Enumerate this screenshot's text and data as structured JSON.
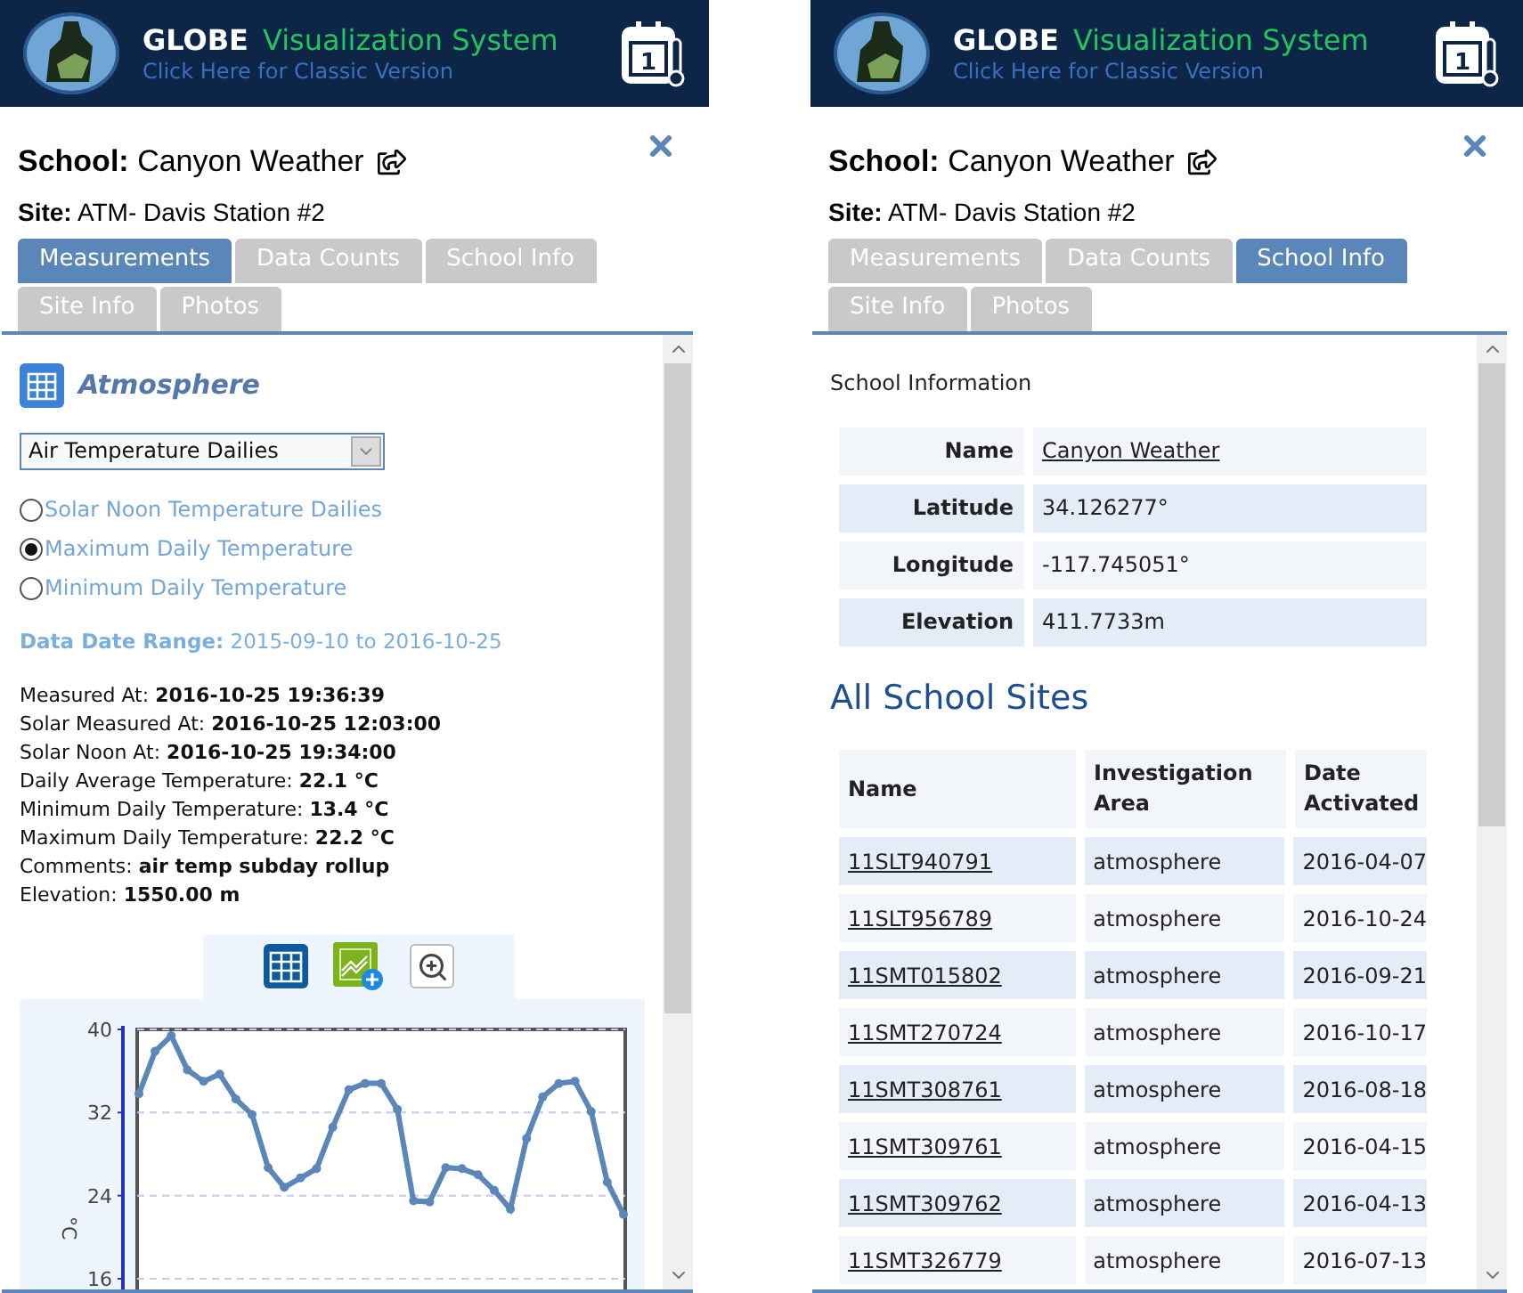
{
  "panels": [
    {
      "header": {
        "brand": "GLOBE",
        "product": "Visualization System",
        "classic_link": "Click Here for Classic Version",
        "calendar_day": "1"
      },
      "school": "**School:** Canyon Weather",
      "site": "**Site:** ATM- Davis Station #2",
      "tabs": [
        {
          "label": "Measurements",
          "selected": true
        },
        {
          "label": "Data Counts",
          "selected": false
        },
        {
          "label": "School Info",
          "selected": false
        },
        {
          "label": "Site Info",
          "selected": false
        },
        {
          "label": "Photos",
          "selected": false
        }
      ],
      "content": {
        "kind": "measurements",
        "category": "Atmosphere",
        "dropdown": {
          "value": "Air Temperature Dailies"
        },
        "options": [
          {
            "label": "Solar Noon Temperature Dailies",
            "selected": false
          },
          {
            "label": "Maximum Daily Temperature",
            "selected": true
          },
          {
            "label": "Minimum Daily Temperature",
            "selected": false
          }
        ],
        "date_range": "**Data Date Range:** 2015-09-10 to 2016-10-25",
        "details": [
          "Measured At: **2016-10-25 19:36:39**",
          "Solar Measured At: **2016-10-25 12:03:00**",
          "Solar Noon At: **2016-10-25 19:34:00**",
          "Daily Average Temperature: **22.1 °C**",
          "Minimum Daily Temperature: **13.4 °C**",
          "Maximum Daily Temperature: **22.2 °C**",
          "Comments: **air temp subday rollup**",
          "Elevation: **1550.00 m**"
        ],
        "chart_data": {
          "type": "line",
          "ylabel": "°C",
          "ylim": [
            16,
            40
          ],
          "yticks": [
            40,
            32,
            24,
            16
          ],
          "series": [
            {
              "color": "#5b87b8",
              "marker": true,
              "values": [
                33.8,
                37.9,
                39.4,
                36.1,
                35.0,
                35.7,
                33.3,
                31.8,
                26.7,
                24.8,
                25.7,
                26.6,
                30.6,
                34.2,
                34.8,
                34.8,
                32.3,
                23.5,
                23.4,
                26.7,
                26.6,
                26.0,
                24.5,
                22.7,
                29.5,
                33.5,
                34.8,
                35.0,
                32.1,
                25.3,
                22.2
              ]
            }
          ]
        }
      }
    },
    {
      "header": {
        "brand": "GLOBE",
        "product": "Visualization System",
        "classic_link": "Click Here for Classic Version",
        "calendar_day": "1"
      },
      "school": "**School:** Canyon Weather",
      "site": "**Site:** ATM- Davis Station #2",
      "tabs": [
        {
          "label": "Measurements",
          "selected": false
        },
        {
          "label": "Data Counts",
          "selected": false
        },
        {
          "label": "School Info",
          "selected": true
        },
        {
          "label": "Site Info",
          "selected": false
        },
        {
          "label": "Photos",
          "selected": false
        }
      ],
      "content": {
        "kind": "school_info",
        "section_title": "School Information",
        "info_rows": [
          {
            "label": "Name",
            "value": "Canyon Weather",
            "kind": "link"
          },
          {
            "label": "Latitude",
            "value": "34.126277°",
            "kind": "text"
          },
          {
            "label": "Longitude",
            "value": "-117.745051°",
            "kind": "text"
          },
          {
            "label": "Elevation",
            "value": "411.7733m",
            "kind": "text"
          }
        ],
        "sites_title": "All School Sites",
        "sites_table": {
          "columns": [
            "Name",
            "Investigation Area",
            "Date Activated"
          ],
          "rows": [
            [
              "11SLT940791",
              "atmosphere",
              "2016-04-07"
            ],
            [
              "11SLT956789",
              "atmosphere",
              "2016-10-24"
            ],
            [
              "11SMT015802",
              "atmosphere",
              "2016-09-21"
            ],
            [
              "11SMT270724",
              "atmosphere",
              "2016-10-17"
            ],
            [
              "11SMT308761",
              "atmosphere",
              "2016-08-18"
            ],
            [
              "11SMT309761",
              "atmosphere",
              "2016-04-15"
            ],
            [
              "11SMT309762",
              "atmosphere",
              "2016-04-13"
            ],
            [
              "11SMT326779",
              "atmosphere",
              "2016-07-13"
            ]
          ]
        }
      }
    }
  ]
}
